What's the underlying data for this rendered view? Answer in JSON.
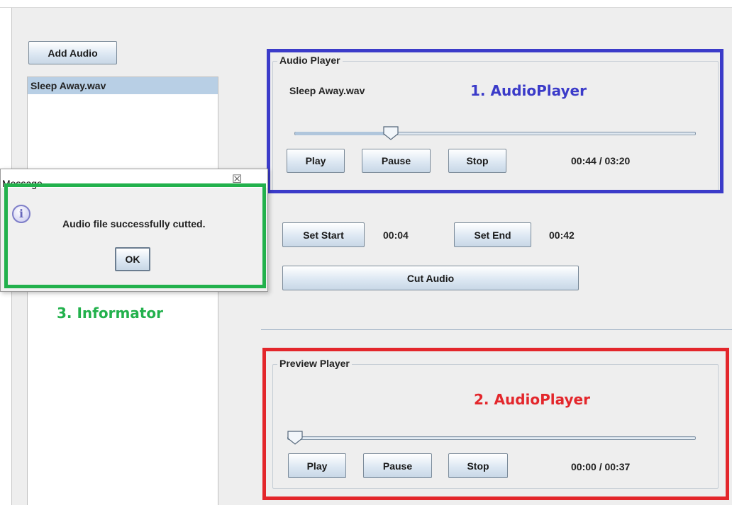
{
  "controls": {
    "add_audio": "Add Audio",
    "playlist": [
      "Sleep Away.wav"
    ],
    "set_start": "Set Start",
    "start_time": "00:04",
    "set_end": "Set End",
    "end_time": "00:42",
    "cut_audio": "Cut Audio"
  },
  "audio_player": {
    "title": "Audio Player",
    "file_name": "Sleep Away.wav",
    "play": "Play",
    "pause": "Pause",
    "stop": "Stop",
    "time": "00:44 / 03:20",
    "progress": 0.22
  },
  "preview_player": {
    "title": "Preview Player",
    "play": "Play",
    "pause": "Pause",
    "stop": "Stop",
    "time": "00:00 / 00:37",
    "progress": 0.0
  },
  "dialog": {
    "title": "Message",
    "message": "Audio file successfully cutted.",
    "ok": "OK"
  },
  "annotations": {
    "audio_player": {
      "text": "1. AudioPlayer",
      "color": "#3b3bc9"
    },
    "preview_player": {
      "text": "2. AudioPlayer",
      "color": "#e3262b"
    },
    "informator": {
      "text": "3. Informator",
      "color": "#22b14c"
    }
  },
  "icons": {
    "dialog_icon": "info-icon",
    "close": "close-icon"
  }
}
